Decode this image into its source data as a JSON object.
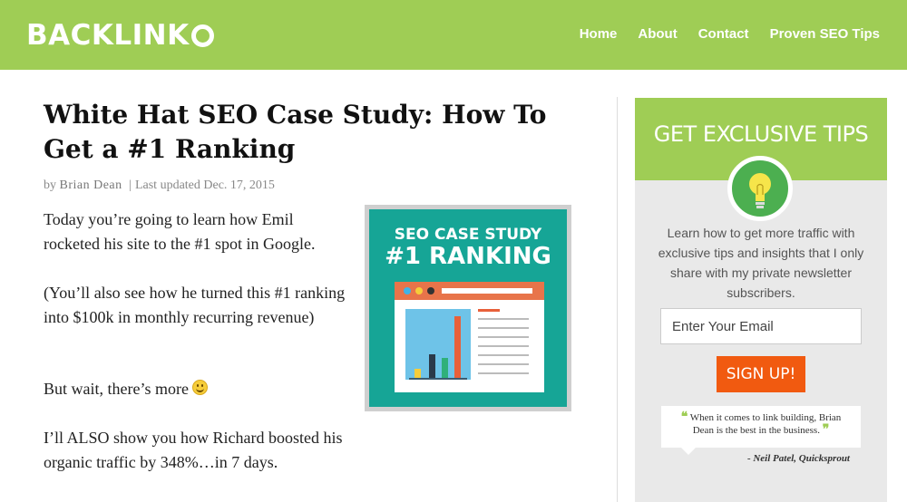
{
  "header": {
    "logo": "BACKLINK",
    "nav": [
      "Home",
      "About",
      "Contact",
      "Proven SEO Tips"
    ]
  },
  "article": {
    "title": "White Hat SEO Case Study: How To Get a #1 Ranking",
    "byline_prefix": "by",
    "author": "Brian Dean",
    "separator": "|",
    "updated": "Last updated Dec. 17, 2015",
    "paragraphs": [
      "Today you’re going to learn how Emil rocketed his site to the #1 spot in Google.",
      "(You’ll also see how he turned this #1 ranking into $100k in monthly recurring revenue)",
      "But wait, there’s more",
      "I’ll ALSO show you how Richard boosted his organic traffic by 348%…in 7 days."
    ],
    "feature_image": {
      "line1": "SEO CASE STUDY",
      "line2": "#1 RANKING"
    }
  },
  "sidebar": {
    "heading": "GET EXCLUSIVE TIPS",
    "description": "Learn how to get more traffic with exclusive tips and insights that I only share with my private newsletter subscribers.",
    "email_placeholder": "Enter Your Email",
    "signup_label": "SIGN UP!",
    "quote_open": "❝",
    "quote_text": "When it comes to link building, Brian Dean is the best in the business.",
    "quote_close": "❞",
    "quote_cite": "- Neil Patel, Quicksprout"
  },
  "colors": {
    "brand_green": "#9fcd55",
    "signup_orange": "#f15a10",
    "feature_teal": "#16a596"
  }
}
